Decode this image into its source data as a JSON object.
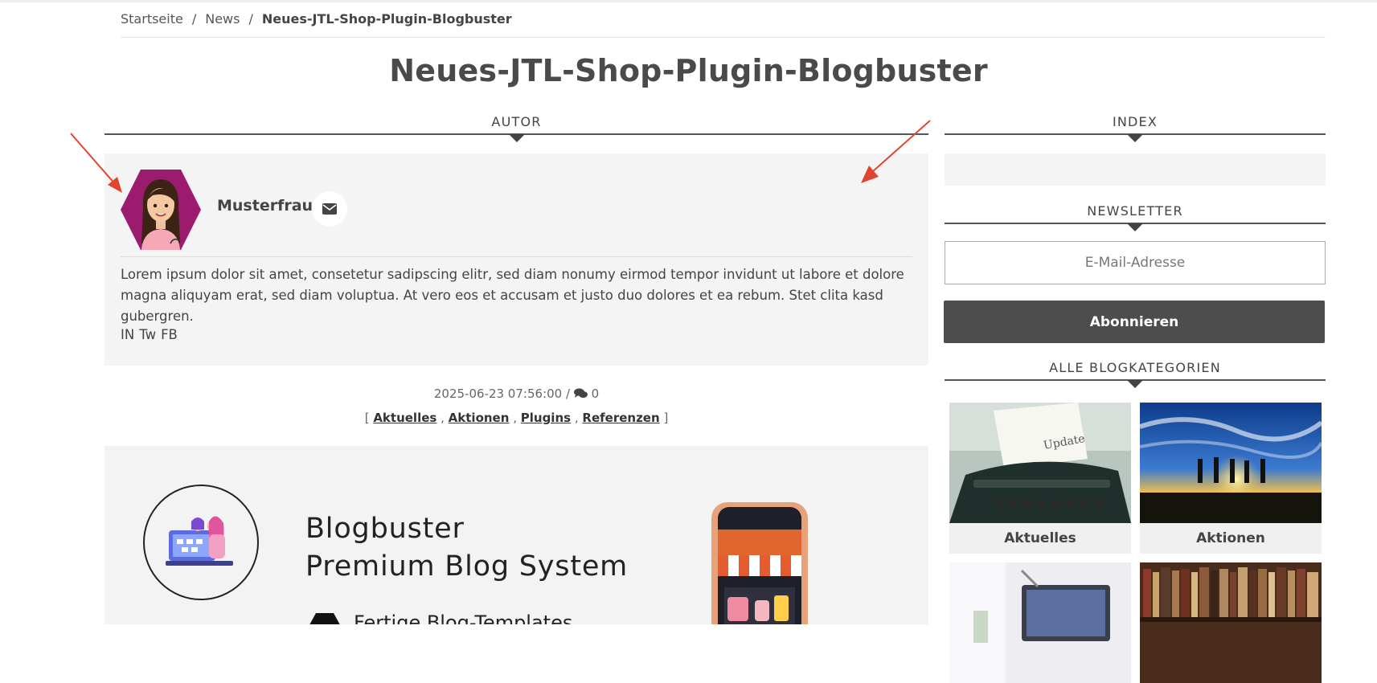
{
  "breadcrumb": {
    "items": [
      {
        "label": "Startseite"
      },
      {
        "label": "News"
      },
      {
        "label": "Neues-JTL-Shop-Plugin-Blogbuster"
      }
    ],
    "separator": "/"
  },
  "page_title": "Neues-JTL-Shop-Plugin-Blogbuster",
  "author_section": {
    "heading": "AUTOR",
    "name": "Musterfrau",
    "bio": "Lorem ipsum dolor sit amet, consetetur sadipscing elitr, sed diam nonumy eirmod tempor invidunt ut labore et dolore magna aliquyam erat, sed diam voluptua. At vero eos et accusam et justo duo dolores et ea rebum. Stet clita kasd gubergren.",
    "social": [
      "IN",
      "Tw",
      "FB"
    ],
    "mail_icon": "envelope-icon"
  },
  "meta": {
    "date": "2025-06-23 07:56:00",
    "separator": "/",
    "comments": "0"
  },
  "categories": {
    "open": "[",
    "close": "]",
    "items": [
      "Aktuelles",
      "Aktionen",
      "Plugins",
      "Referenzen"
    ],
    "separator": ","
  },
  "banner": {
    "title_line1": "Blogbuster",
    "title_line2": "Premium Blog System",
    "feature_text": "Fertige Blog-Templates"
  },
  "sidebar": {
    "index_heading": "INDEX",
    "newsletter_heading": "NEWSLETTER",
    "newsletter_placeholder": "E-Mail-Adresse",
    "newsletter_button": "Abonnieren",
    "categories_heading": "ALLE BLOGKATEGORIEN",
    "category_tiles": [
      {
        "label": "Aktuelles"
      },
      {
        "label": "Aktionen"
      }
    ]
  },
  "colors": {
    "annotation_arrow": "#e0452f",
    "button_bg": "#4d4d4d",
    "avatar_hex": "#9c1b6f"
  }
}
